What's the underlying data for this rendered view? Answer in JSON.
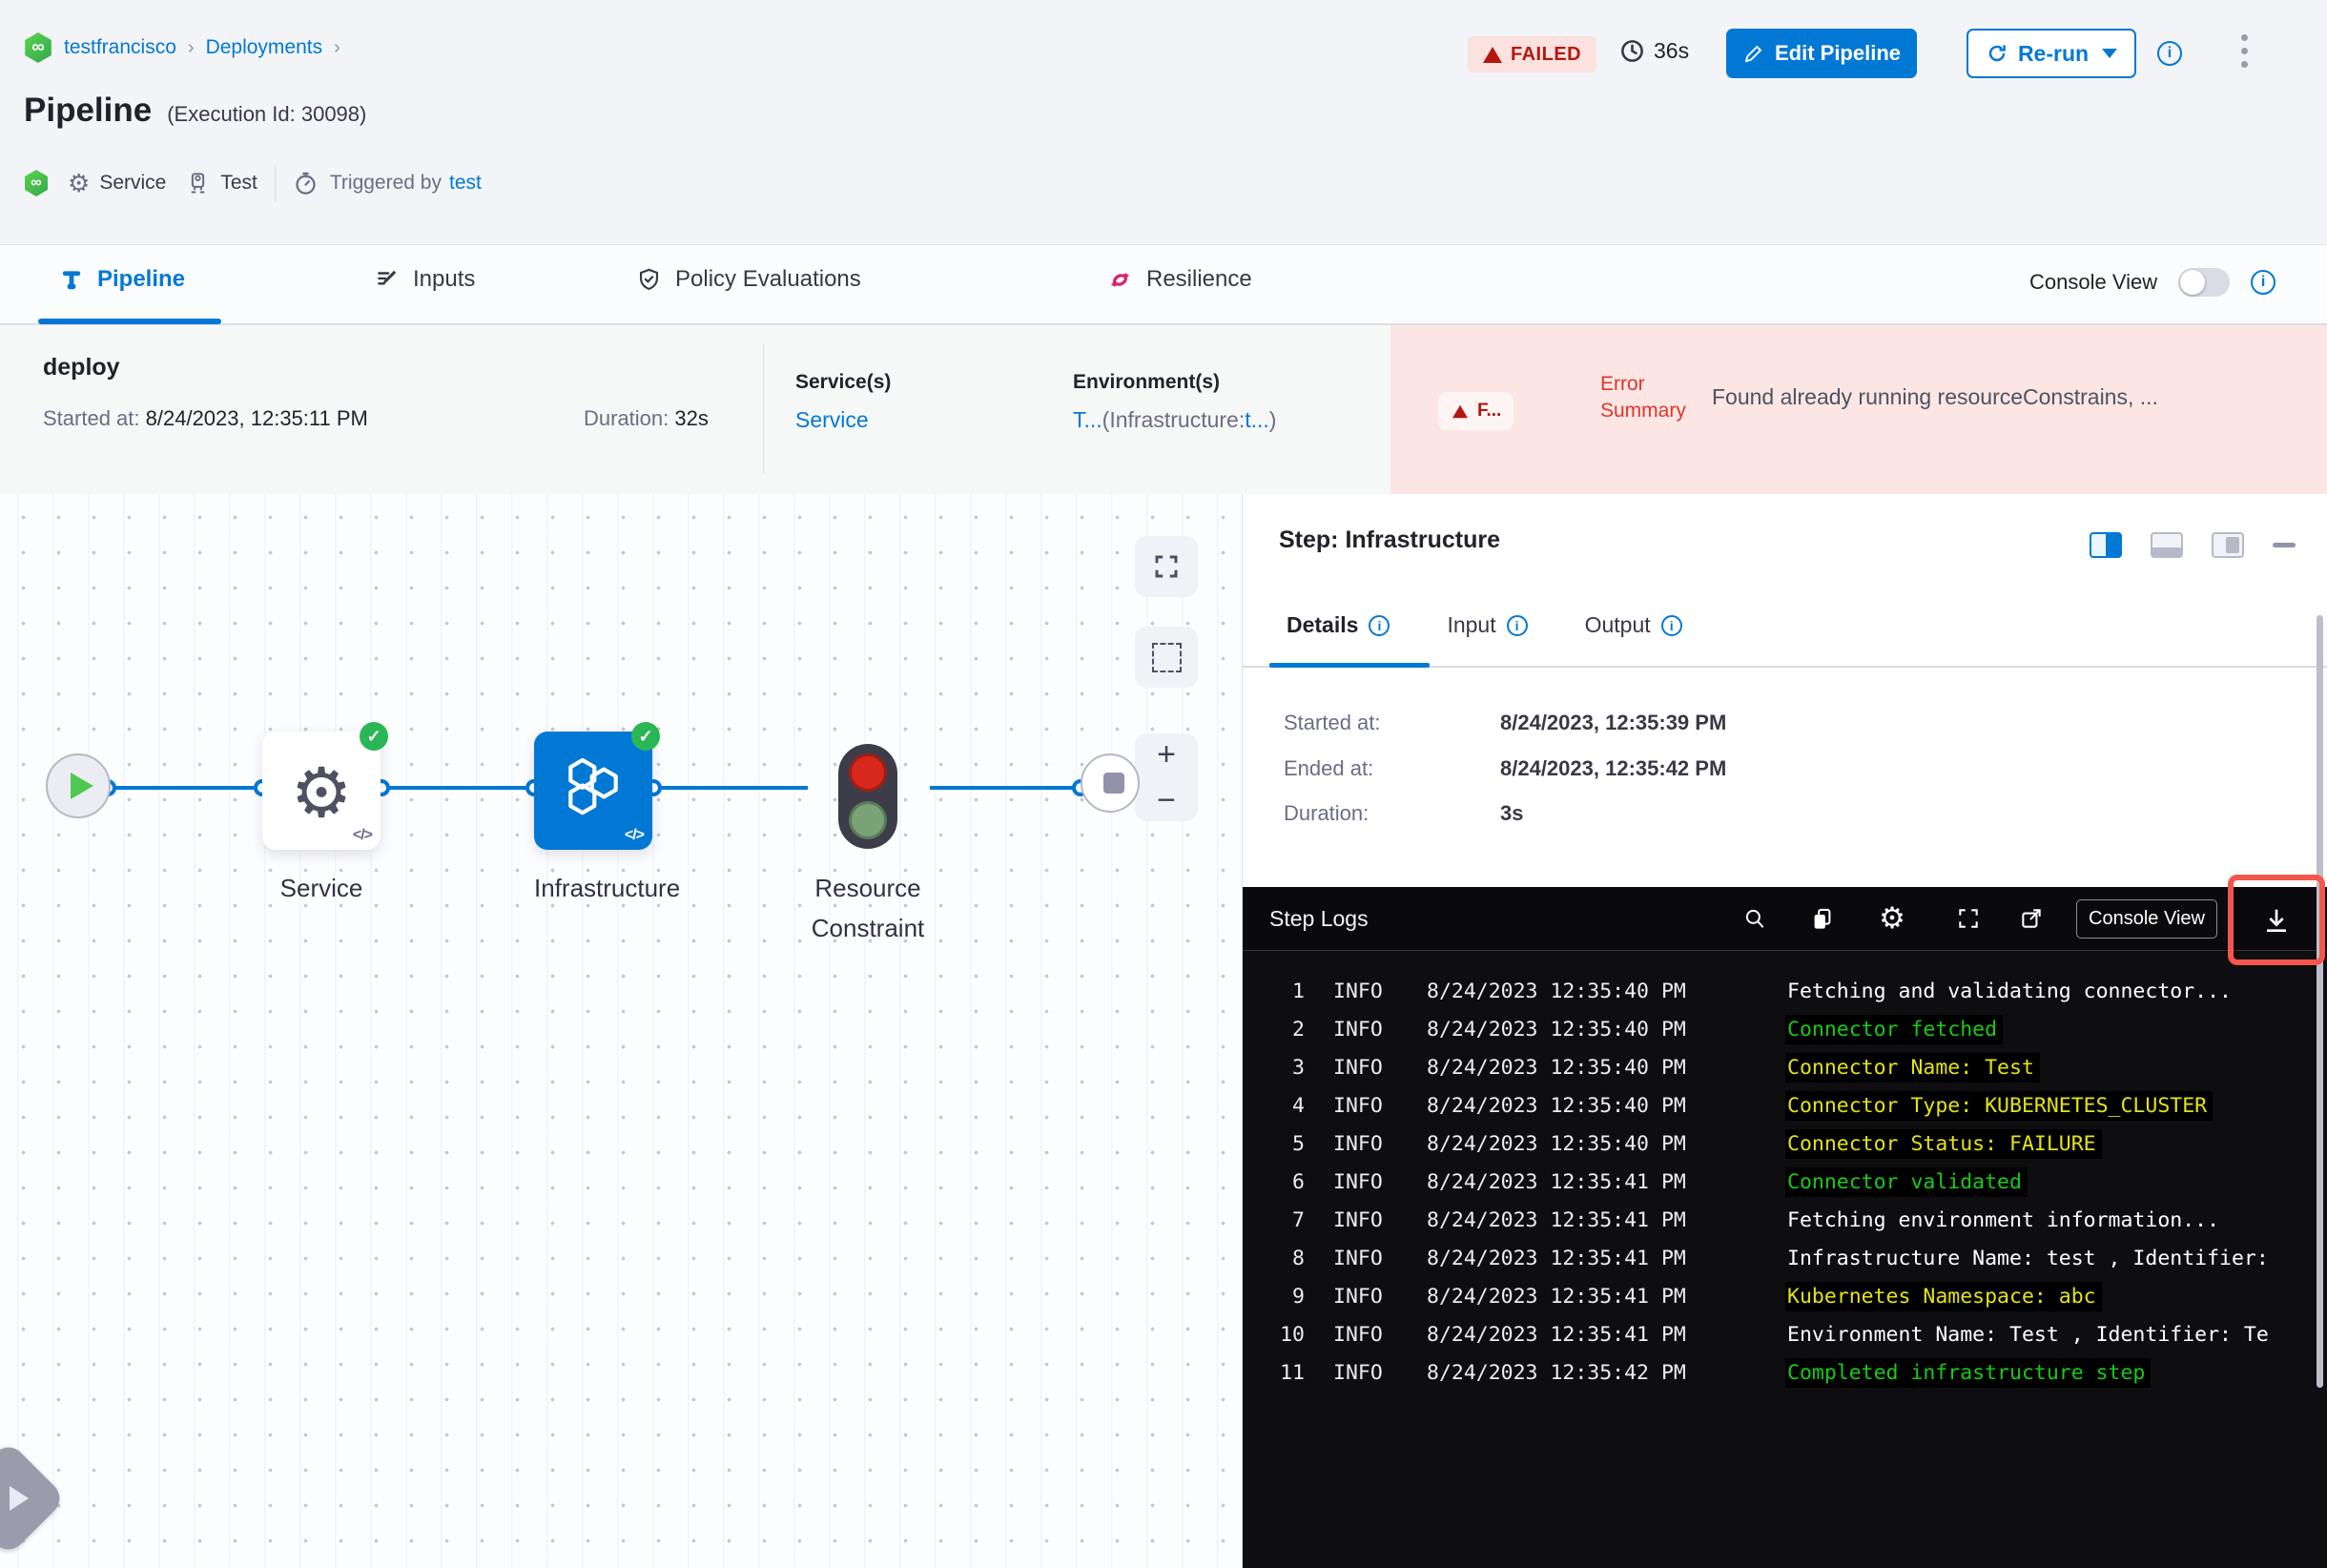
{
  "colors": {
    "accent": "#0278d5",
    "failed_red": "#b41710",
    "error_bg": "#fbe6e4",
    "success_green": "#2bb656",
    "log_green": "#17cb17",
    "log_yellow": "#e3e315",
    "highlight_red": "#f4564d"
  },
  "header": {
    "breadcrumb": {
      "project": "testfrancisco",
      "section": "Deployments",
      "chevron": "›"
    },
    "title": "Pipeline",
    "execution_id": "(Execution Id: 30098)",
    "status_badge": "FAILED",
    "elapsed": "36s",
    "edit_button": "Edit Pipeline",
    "rerun_button": "Re-run",
    "service_tag": "Service",
    "env_tag": "Test",
    "triggered_by_label": "Triggered by",
    "triggered_by_user": "test"
  },
  "tabs": {
    "items": [
      {
        "label": "Pipeline"
      },
      {
        "label": "Inputs"
      },
      {
        "label": "Policy Evaluations"
      },
      {
        "label": "Resilience"
      }
    ],
    "console_view_label": "Console View"
  },
  "stage": {
    "name": "deploy",
    "started_label": "Started at:",
    "started_value": "8/24/2023, 12:35:11 PM",
    "duration_label": "Duration:",
    "duration_value": "32s",
    "services_label": "Service(s)",
    "services_value": "Service",
    "environments_label": "Environment(s)",
    "env_part1": "T...",
    "env_part2": "(Infrastructure:",
    "env_part3": "t...",
    "env_part4": ")",
    "failed_badge": "F...",
    "error_label_line1": "Error",
    "error_label_line2": "Summary",
    "error_message": "Found already running resourceConstrains, ..."
  },
  "graph": {
    "service_label": "Service",
    "infrastructure_label": "Infrastructure",
    "resource_label_line1": "Resource",
    "resource_label_line2": "Constraint",
    "code_glyph": "</>",
    "zoom_in": "+",
    "zoom_out": "−"
  },
  "panel": {
    "title": "Step: Infrastructure",
    "tabs": [
      {
        "label": "Details"
      },
      {
        "label": "Input"
      },
      {
        "label": "Output"
      }
    ],
    "details": {
      "started_label": "Started at:",
      "started_value": "8/24/2023, 12:35:39 PM",
      "ended_label": "Ended at:",
      "ended_value": "8/24/2023, 12:35:42 PM",
      "duration_label": "Duration:",
      "duration_value": "3s"
    }
  },
  "logs": {
    "title": "Step Logs",
    "console_view_button": "Console View",
    "lines": [
      {
        "n": "1",
        "level": "INFO",
        "time": "8/24/2023 12:35:40 PM",
        "msg": "Fetching and validating connector...",
        "color": "white",
        "hl": false
      },
      {
        "n": "2",
        "level": "INFO",
        "time": "8/24/2023 12:35:40 PM",
        "msg": "Connector fetched",
        "color": "green",
        "hl": true
      },
      {
        "n": "3",
        "level": "INFO",
        "time": "8/24/2023 12:35:40 PM",
        "msg": "Connector Name: Test",
        "color": "yellow",
        "hl": true
      },
      {
        "n": "4",
        "level": "INFO",
        "time": "8/24/2023 12:35:40 PM",
        "msg": "Connector Type: KUBERNETES_CLUSTER",
        "color": "yellow",
        "hl": true
      },
      {
        "n": "5",
        "level": "INFO",
        "time": "8/24/2023 12:35:40 PM",
        "msg": "Connector Status: FAILURE",
        "color": "yellow",
        "hl": true
      },
      {
        "n": "6",
        "level": "INFO",
        "time": "8/24/2023 12:35:41 PM",
        "msg": "Connector validated",
        "color": "green",
        "hl": true
      },
      {
        "n": "7",
        "level": "INFO",
        "time": "8/24/2023 12:35:41 PM",
        "msg": "Fetching environment information...",
        "color": "white",
        "hl": false
      },
      {
        "n": "8",
        "level": "INFO",
        "time": "8/24/2023 12:35:41 PM",
        "msg": "Infrastructure Name: test , Identifier:",
        "color": "white",
        "hl": false
      },
      {
        "n": "9",
        "level": "INFO",
        "time": "8/24/2023 12:35:41 PM",
        "msg": "Kubernetes Namespace: abc",
        "color": "yellow",
        "hl": true
      },
      {
        "n": "10",
        "level": "INFO",
        "time": "8/24/2023 12:35:41 PM",
        "msg": "Environment Name: Test , Identifier: Te",
        "color": "white",
        "hl": false
      },
      {
        "n": "11",
        "level": "INFO",
        "time": "8/24/2023 12:35:42 PM",
        "msg": "Completed infrastructure step",
        "color": "green",
        "hl": true
      }
    ]
  }
}
